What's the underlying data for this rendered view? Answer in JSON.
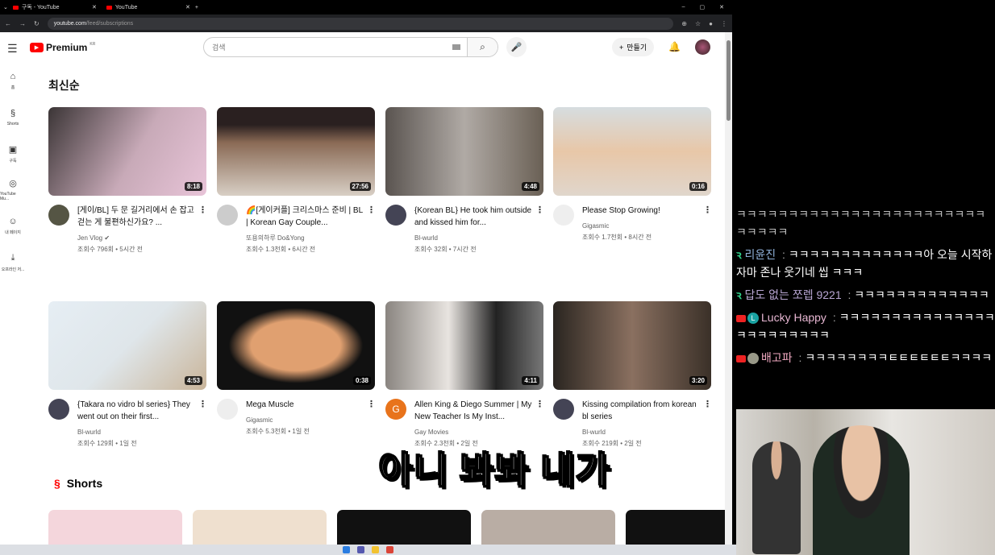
{
  "browser": {
    "tabs": [
      {
        "label": "구독 - YouTube"
      },
      {
        "label": "YouTube"
      }
    ],
    "url_host": "youtube.com",
    "url_path": "/feed/subscriptions"
  },
  "header": {
    "logo": "Premium",
    "region": "KR",
    "search_placeholder": "검색",
    "create_label": "만들기"
  },
  "sidebar": {
    "items": [
      {
        "label": "홈",
        "icon": "home-icon",
        "glyph": "⌂"
      },
      {
        "label": "Shorts",
        "icon": "shorts-icon",
        "glyph": "§"
      },
      {
        "label": "구독",
        "icon": "subscriptions-icon",
        "glyph": "▣"
      },
      {
        "label": "YouTube Mu...",
        "icon": "music-icon",
        "glyph": "◎"
      },
      {
        "label": "내 페이지",
        "icon": "profile-icon",
        "glyph": "☺"
      },
      {
        "label": "오프라인 저...",
        "icon": "download-icon",
        "glyph": "⤓"
      }
    ]
  },
  "main": {
    "section_title": "최신순",
    "videos": [
      {
        "title": "[게이/BL] 두 문 길거리에서 손 잡고 걷는 게 불편하신가요? ...",
        "channel": "Jen Vlog",
        "verified": true,
        "stats": "조회수 796회 • 5시간 전",
        "duration": "8:18",
        "thumb": "linear-gradient(120deg,#3b3536,#c8aab8 55%,#e8c4d8)",
        "av": "#554"
      },
      {
        "title": "🌈[게이커플] 크리스마스 준비 | BL | Korean Gay Couple...",
        "channel": "또용의하루 Do&Yong",
        "stats": "조회수 1.3천회 • 6시간 전",
        "duration": "27:56",
        "thumb": "linear-gradient(180deg,#2a2020 0 20%,#8a6a55 40%,#d8cfc5)",
        "av": "#ccc"
      },
      {
        "title": "{Korean BL} He took him outside and kissed him for...",
        "channel": "Bl-wurld",
        "stats": "조회수 32회 • 7시간 전",
        "duration": "4:48",
        "thumb": "linear-gradient(90deg,#5a5450,#b0aaa5 50%,#6a6055)",
        "av": "#445"
      },
      {
        "title": "Please Stop Growing!",
        "channel": "Gigasmic",
        "stats": "조회수 1.7천회 • 8시간 전",
        "duration": "0:16",
        "thumb": "linear-gradient(180deg,#d6dde0,#e8c7a8 50%,#e0d6cc)",
        "av": "#eee"
      },
      {
        "title": "{Takara no vidro bl series} They went out on their first...",
        "channel": "Bl-wurld",
        "stats": "조회수 129회 • 1일 전",
        "duration": "4:53",
        "thumb": "linear-gradient(135deg,#e6eef4,#dfe6ea 50%,#c9b59a)",
        "av": "#445"
      },
      {
        "title": "Mega Muscle",
        "channel": "Gigasmic",
        "stats": "조회수 5.3천회 • 1일 전",
        "duration": "0:38",
        "thumb": "radial-gradient(ellipse at 50% 50%,#e0a070 0 40%,#111 60%)",
        "av": "#eee"
      },
      {
        "title": "Allen King & Diego Summer | My New Teacher Is My Inst...",
        "channel": "Gay Movies",
        "stats": "조회수 2.3천회 • 2일 전",
        "duration": "4:11",
        "thumb": "linear-gradient(90deg,#8a8580,#e8e4e0 40%,#222 70%,#777)",
        "av": "#e8731b",
        "av_letter": "G"
      },
      {
        "title": "Kissing compilation from korean bl series",
        "channel": "Bl-wurld",
        "stats": "조회수 219회 • 2일 전",
        "duration": "3:20",
        "thumb": "linear-gradient(90deg,#2a2520,#8a7060 50%,#3a3028)",
        "av": "#445"
      }
    ]
  },
  "shorts": {
    "title": "Shorts",
    "thumbs": [
      "#f4d6dc",
      "#efe0cf",
      "#111111",
      "#b9ada4",
      "#111111"
    ]
  },
  "caption": "아니 봐봐 내가",
  "chat": {
    "messages": [
      {
        "name": "",
        "text": "ㅋㅋㅋㅋㅋㅋㅋㅋㅋㅋㅋㅋㅋㅋㅋㅋㅋㅋㅋㅋㅋㅋㅋㅋㅋㅋㅋㅋㅋ",
        "name_color": "#aaa",
        "dim": true
      },
      {
        "name": "리윤진",
        "text": "ㅋㅋㅋㅋㅋㅋㅋㅋㅋㅋㅋㅋㅋ아 오늘 시작하자마 존나 웃기네 씹 ㅋㅋㅋ",
        "name_color": "#8fb0d8",
        "badge": "green"
      },
      {
        "name": "답도 없는 쪼렙 9221",
        "text": "ㅋㅋㅋㅋㅋㅋㅋㅋㅋㅋㅋㅋㅋ",
        "name_color": "#b9a7d4",
        "badge": "green"
      },
      {
        "name": "Lucky Happy",
        "text": "ㅋㅋㅋㅋㅋㅋㅋㅋㅋㅋㅋㅋㅋㅋㅋㅋㅋㅋㅋㅋㅋㅋㅋㅋ",
        "name_color": "#e9b8d4",
        "badge": "youtube",
        "av": "#1aa3a3",
        "av_letter": "L"
      },
      {
        "name": "배고파",
        "text": "ㅋㅋㅋㅋㅋㅋㅋㅋㅌㅌㅌㅌㅌㅌㅋㅋㅋㅋ",
        "name_color": "#f0a8c0",
        "badge": "youtube",
        "av": "#998"
      }
    ]
  }
}
